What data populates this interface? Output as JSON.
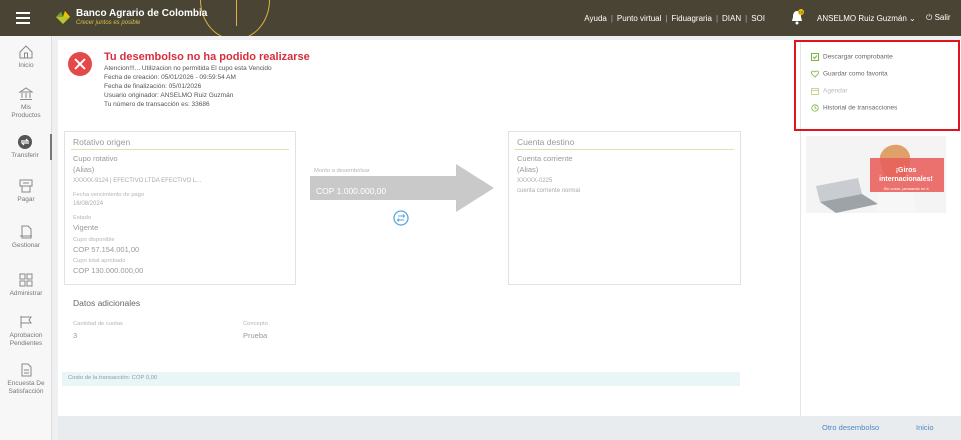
{
  "header": {
    "brand": "Banco Agrario de Colombia",
    "tagline": "Crecer juntos es posible",
    "nav": [
      "Ayuda",
      "Punto virtual",
      "Fiduagraria",
      "DIAN",
      "SOI"
    ],
    "notification_count": "10",
    "user": "ANSELMO Ruiz Guzmán",
    "logout": "Salir",
    "colors": {
      "bar": "#4a4434",
      "accent": "#d9b33a"
    }
  },
  "sidebar": {
    "items": [
      {
        "label": "Inicio",
        "icon": "home-icon"
      },
      {
        "label": "Mis Productos",
        "icon": "bank-icon"
      },
      {
        "label": "Transferir",
        "icon": "transfer-icon"
      },
      {
        "label": "Pagar",
        "icon": "cash-register-icon"
      },
      {
        "label": "Gestionar",
        "icon": "document-icon"
      },
      {
        "label": "Administrar",
        "icon": "grid-icon"
      },
      {
        "label": "Aprobacion Pendientes",
        "icon": "flag-icon"
      },
      {
        "label": "Encuesta De Satisfacción",
        "icon": "survey-icon"
      }
    ],
    "active": "Transferir"
  },
  "result": {
    "title": "Tu desembolso no ha podido realizarse",
    "message": "Atencion!!!... Utilizacion no permitida El cupo esta Vencido",
    "created": "Fecha de creación: 05/01/2026 - 09:59:54 AM",
    "finished": "Fecha de finalización: 05/01/2026",
    "originator": "Usuario originador: ANSELMO Ruiz Guzmán",
    "transaction": "Tu número de transacción es: 33686",
    "color": "#e5474b"
  },
  "origin": {
    "title": "Rotativo origen",
    "product": "Cupo rotativo",
    "alias": "(Alias)",
    "account": "XXXXX-9124 | EFECTIVO LTDA EFECTIVO L...",
    "due_label": "Fecha vencimiento de pago",
    "due_value": "16/08/2024",
    "state_label": "Estado",
    "state_value": "Vigente",
    "available_label": "Cupo disponible",
    "available_value": "COP 57.154.001,00",
    "total_label": "Cupo total aprobado",
    "total_value": "COP 130.000.000,00"
  },
  "transfer": {
    "amount_label": "Monto a desembolsar",
    "amount_value": "COP 1.000.000,00"
  },
  "destination": {
    "title": "Cuenta destino",
    "product": "Cuenta corriente",
    "alias": "(Alias)",
    "account": "XXXXX-0225",
    "type": "cuenta corriente normal"
  },
  "extra": {
    "title": "Datos adicionales",
    "installments_label": "Cantidad de cuotas",
    "installments_value": "3",
    "concept_label": "Concepto",
    "concept_value": "Prueba"
  },
  "cost": "Costo de la transacción: COP 0,00",
  "actions": [
    {
      "label": "Descargar comprobante",
      "icon": "download-icon",
      "enabled": true
    },
    {
      "label": "Guardar como favorita",
      "icon": "heart-icon",
      "enabled": true
    },
    {
      "label": "Agendar",
      "icon": "calendar-icon",
      "enabled": false
    },
    {
      "label": "Historial de transacciones",
      "icon": "history-icon",
      "enabled": true
    }
  ],
  "promo": {
    "headline": "¡Giros internacionales!",
    "sub": "Sin costo, pensando en ti"
  },
  "footer": {
    "other": "Otro desembolso",
    "home": "Inicio"
  }
}
